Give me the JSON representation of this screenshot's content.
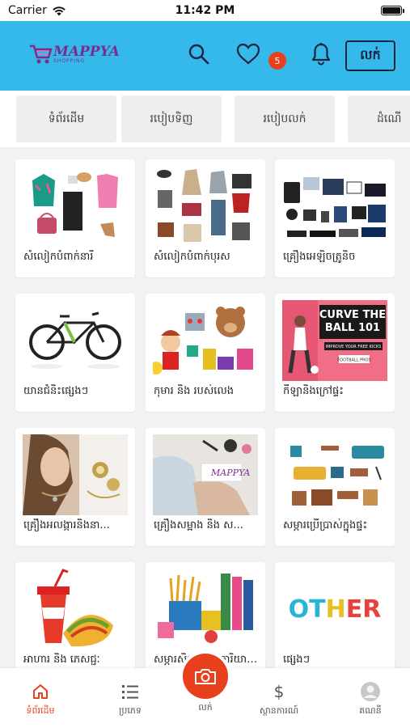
{
  "status_bar": {
    "carrier": "Carrier",
    "time": "11:42 PM"
  },
  "header": {
    "logo_text": "MAPPYA",
    "logo_subtitle": "SHOPPING",
    "favorites_badge": "5",
    "sell_label": "លក់",
    "colors": {
      "header_bg": "#35b9ea",
      "accent": "#e8401c",
      "logo": "#7b2c8f"
    }
  },
  "tabs": [
    {
      "label": "ទំព័រដើម"
    },
    {
      "label": "របៀបទិញ"
    },
    {
      "label": "របៀបលក់"
    },
    {
      "label": "ដំណើ"
    }
  ],
  "categories": [
    {
      "label": "សំលៀកបំពាក់នារី",
      "icon": "womens-clothing-image"
    },
    {
      "label": "សំលៀកបំពាក់បុរស",
      "icon": "mens-clothing-image"
    },
    {
      "label": "គ្រឿងអេឡិចត្រូនិច",
      "icon": "electronics-image"
    },
    {
      "label": "យានជំនិះផ្សេងៗ",
      "icon": "bicycle-image"
    },
    {
      "label": "កុមារ និង របស់លេង",
      "icon": "toys-image"
    },
    {
      "label": "កីឡានិងក្រៅផ្ទះ",
      "icon": "sports-image"
    },
    {
      "label": "គ្រឿងអលង្ការនិងនា...",
      "icon": "jewelry-image"
    },
    {
      "label": "គ្រឿងសម្អាង និង ស...",
      "icon": "cosmetics-image"
    },
    {
      "label": "សម្ភារប្រើប្រាស់ក្នុងផ្ទះ",
      "icon": "furniture-image"
    },
    {
      "label": "អាហារ និង ភេសជ្ជៈ",
      "icon": "food-image"
    },
    {
      "label": "សម្ភារសិក្សា និង ការិយាល័យ",
      "icon": "stationery-image"
    },
    {
      "label": "ផ្សេងៗ",
      "icon": "other-image",
      "image_text": "OTHER"
    }
  ],
  "sports_banner": {
    "line1": "CURVE THE",
    "line2": "BALL 101",
    "line3": "IMPROVE YOUR FREE KICKS",
    "line4": "FOOTBALL PROS"
  },
  "bottom_nav": {
    "home": "ទំព័រដើម",
    "category": "ប្រភេទ",
    "sell": "លក់",
    "finance": "ស្ថានការណ៍",
    "account": "គណនី"
  }
}
